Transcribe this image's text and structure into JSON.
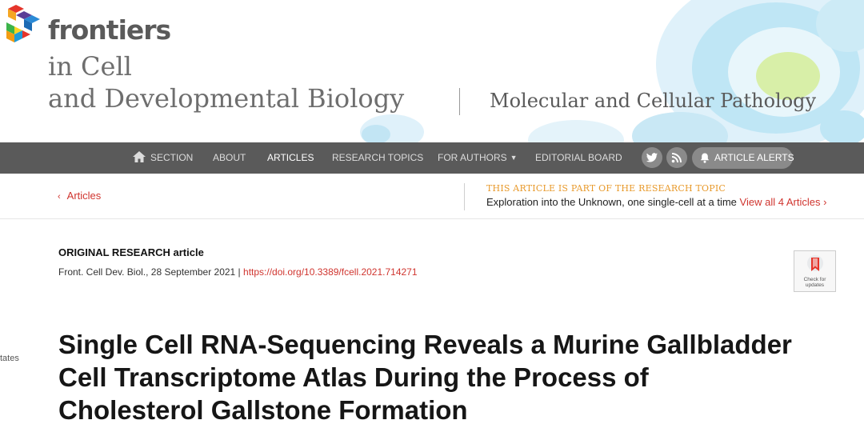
{
  "header": {
    "brand": "frontiers",
    "journal_line1": "in Cell",
    "journal_line2": "and Developmental Biology",
    "section_name": "Molecular and Cellular Pathology"
  },
  "nav": {
    "items": [
      {
        "label": "SECTION",
        "icon": "home-icon"
      },
      {
        "label": "ABOUT"
      },
      {
        "label": "ARTICLES",
        "active": true
      },
      {
        "label": "RESEARCH TOPICS"
      },
      {
        "label": "FOR AUTHORS",
        "has_dropdown": true
      },
      {
        "label": "EDITORIAL BOARD"
      }
    ],
    "social": [
      "twitter-icon",
      "rss-icon"
    ],
    "alerts_label": "ARTICLE ALERTS"
  },
  "topic_bar": {
    "back_label": "Articles",
    "topic_label": "THIS ARTICLE IS PART OF THE RESEARCH TOPIC",
    "topic_title": "Exploration into the Unknown, one single-cell at a time",
    "view_all": "View all 4 Articles"
  },
  "article": {
    "type": "ORIGINAL RESEARCH article",
    "citation": "Front. Cell Dev. Biol., 28 September 2021 | ",
    "doi": "https://doi.org/10.3389/fcell.2021.714271",
    "check_updates": "Check for updates",
    "side_text": "tates",
    "title_lines": [
      "Single Cell RNA-Sequencing Reveals a Murine Gallbladder",
      "Cell Transcriptome Atlas During the Process of",
      "Cholesterol Gallstone Formation"
    ]
  },
  "colors": {
    "accent": "#d0352f",
    "topic_label": "#e89a2c",
    "nav_bg": "#5a5a5a"
  }
}
